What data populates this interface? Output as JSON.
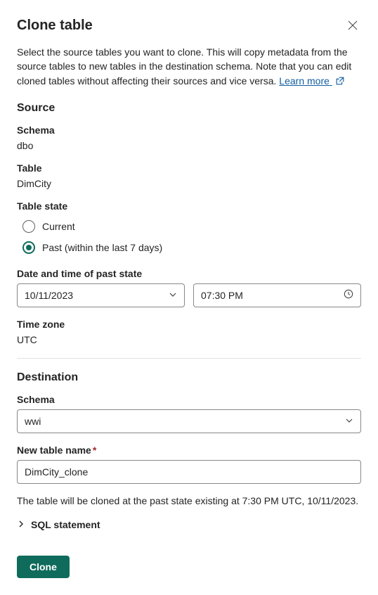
{
  "header": {
    "title": "Clone table"
  },
  "description": {
    "text": "Select the source tables you want to clone. This will copy metadata from the source tables to new tables in the destination schema. Note that you can edit cloned tables without affecting their sources and vice versa. ",
    "learn_more": "Learn more "
  },
  "source": {
    "heading": "Source",
    "schema_label": "Schema",
    "schema_value": "dbo",
    "table_label": "Table",
    "table_value": "DimCity",
    "state_label": "Table state",
    "radio_current": "Current",
    "radio_past": "Past (within the last 7 days)",
    "date_label": "Date and time of past state",
    "date_value": "10/11/2023",
    "time_value": "07:30 PM",
    "tz_label": "Time zone",
    "tz_value": "UTC"
  },
  "destination": {
    "heading": "Destination",
    "schema_label": "Schema",
    "schema_value": "wwi",
    "name_label": "New table name",
    "name_value": "DimCity_clone"
  },
  "status_text": "The table will be cloned at the past state existing at 7:30 PM UTC, 10/11/2023.",
  "sql_statement_label": "SQL statement",
  "footer": {
    "clone_label": "Clone"
  }
}
